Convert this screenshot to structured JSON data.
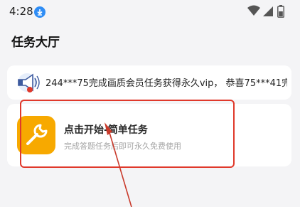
{
  "status_bar": {
    "time": "4:28",
    "icons": [
      "download-icon",
      "wifi-icon",
      "signal-icon",
      "battery-icon"
    ]
  },
  "page": {
    "title": "任务大厅"
  },
  "marquee": {
    "icon": "megaphone-icon",
    "text": "244***75完成画质会员任务获得永久vip， 恭喜75***41完成画"
  },
  "task": {
    "icon": "wrench-icon",
    "title": "点击开始-简单任务",
    "description": "完成答题任务后即可永久免费使用"
  },
  "colors": {
    "accent": "#f7a900",
    "annotation": "#e0392b",
    "download_badge": "#2f8df5"
  }
}
